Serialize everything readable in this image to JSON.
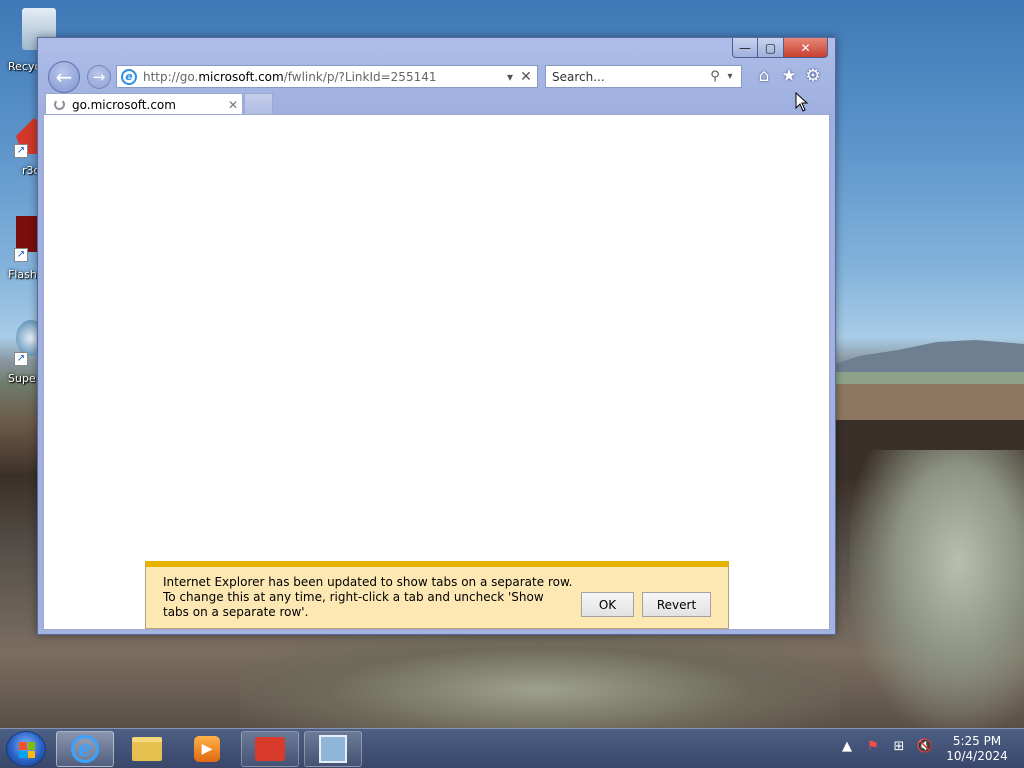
{
  "desktop": {
    "icons": [
      {
        "label": "Recyc"
      },
      {
        "label": "r3c"
      },
      {
        "label": "Flash"
      },
      {
        "label": "Supe"
      }
    ]
  },
  "browser": {
    "caption": {
      "minimize": "—",
      "maximize": "▢",
      "close": "✕"
    },
    "back_glyph": "←",
    "forward_glyph": "→",
    "address": {
      "scheme": "http://go.",
      "host": "microsoft.com",
      "path": "/fwlink/p/?LinkId=255141",
      "dropdown": "▾",
      "stop": "✕"
    },
    "search": {
      "placeholder": "Search...",
      "icon": "⚲",
      "dropdown": "▾"
    },
    "commands": {
      "home": "⌂",
      "favorites": "★",
      "tools": "⚙"
    },
    "tab": {
      "title": "go.microsoft.com",
      "close": "✕"
    }
  },
  "notification": {
    "line1": "Internet Explorer has been updated to show tabs on a separate row.",
    "line2": "To change this at any time, right-click a tab and uncheck 'Show tabs on a separate row'.",
    "ok_label": "OK",
    "revert_label": "Revert"
  },
  "taskbar": {
    "apps": [
      {
        "name": "Internet Explorer",
        "state": "active"
      },
      {
        "name": "File Explorer"
      },
      {
        "name": "Media Player"
      },
      {
        "name": "App",
        "state": "open"
      },
      {
        "name": "Network",
        "state": "open"
      }
    ],
    "tray": {
      "up": "▲",
      "flag": "⚑",
      "network": "⊞",
      "volume": "🔇"
    },
    "clock": {
      "time": "5:25 PM",
      "date": "10/4/2024"
    }
  },
  "colors": {
    "notification_bg": "#fde8b4",
    "notification_accent": "#e6b400",
    "window_frame": "#a3b2df",
    "close_button": "#c7402f"
  }
}
